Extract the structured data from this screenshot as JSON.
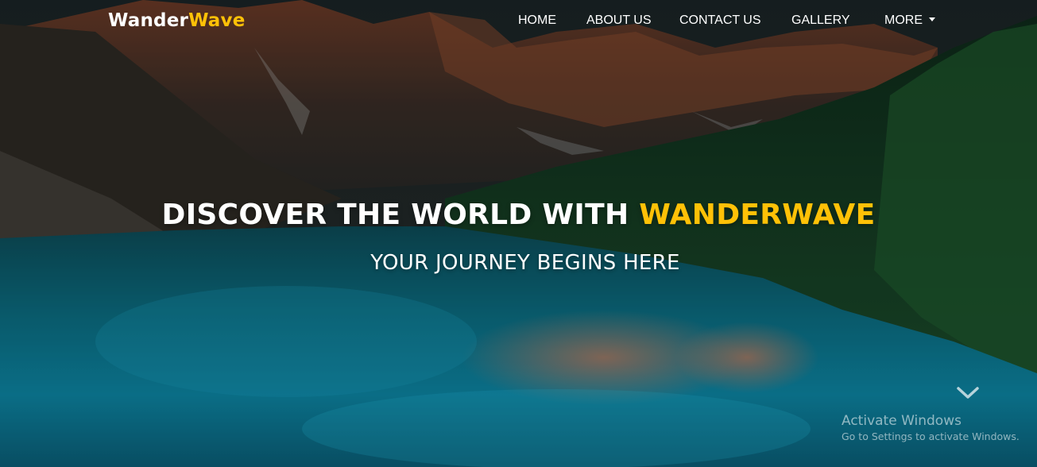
{
  "brand": {
    "name_part1": "Wander",
    "name_part2": "Wave"
  },
  "nav": {
    "items": [
      {
        "label": "HOME"
      },
      {
        "label": "ABOUT US"
      },
      {
        "label": "CONTACT US"
      },
      {
        "label": "GALLERY"
      },
      {
        "label": "MORE",
        "icon": "caret-down-icon"
      }
    ]
  },
  "hero": {
    "title_part1": "DISCOVER THE WORLD WITH ",
    "title_part2": "WANDERWAVE",
    "subtitle": "YOUR JOURNEY BEGINS HERE",
    "scroll_icon": "chevron-down-icon"
  },
  "watermark": {
    "title": "Activate Windows",
    "subtitle": "Go to Settings to activate Windows."
  },
  "colors": {
    "accent": "#ffc107",
    "text": "#ffffff"
  }
}
